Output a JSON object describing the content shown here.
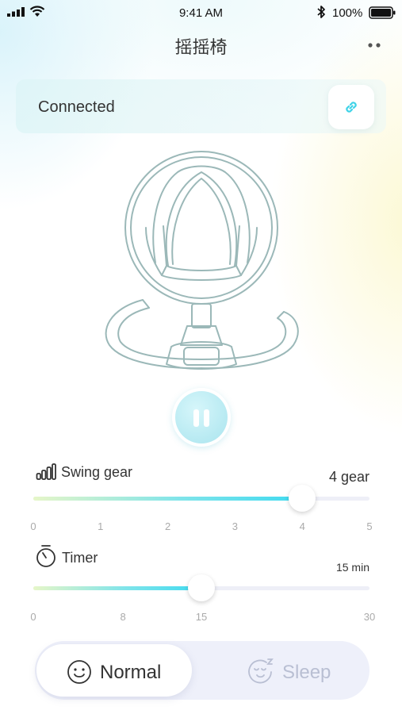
{
  "status_bar": {
    "time": "9:41 AM",
    "battery": "100%"
  },
  "header": {
    "title": "摇摇椅",
    "more_icon": "more-dots-icon"
  },
  "connection": {
    "status": "Connected",
    "icon": "link-icon",
    "accent": "#3fd3e8"
  },
  "playback": {
    "icon": "pause-icon"
  },
  "swing_gear": {
    "label": "Swing gear",
    "icon": "bars-level-icon",
    "value_text": "4 gear",
    "value": 4,
    "min": 0,
    "max": 5,
    "ticks": [
      "0",
      "1",
      "2",
      "3",
      "4",
      "5"
    ]
  },
  "timer": {
    "label": "Timer",
    "icon": "stopwatch-icon",
    "value_text": "15 min",
    "value": 15,
    "min": 0,
    "max": 30,
    "ticks": [
      "0",
      "8",
      "15",
      "30"
    ]
  },
  "modes": {
    "normal_label": "Normal",
    "sleep_label": "Sleep",
    "selected": "Normal",
    "normal_icon": "smiley-icon",
    "sleep_icon": "sleepy-face-icon"
  },
  "colors": {
    "accent": "#3fdaf0",
    "inactive_text": "#b9bfd3",
    "track": "#eeeff7"
  }
}
